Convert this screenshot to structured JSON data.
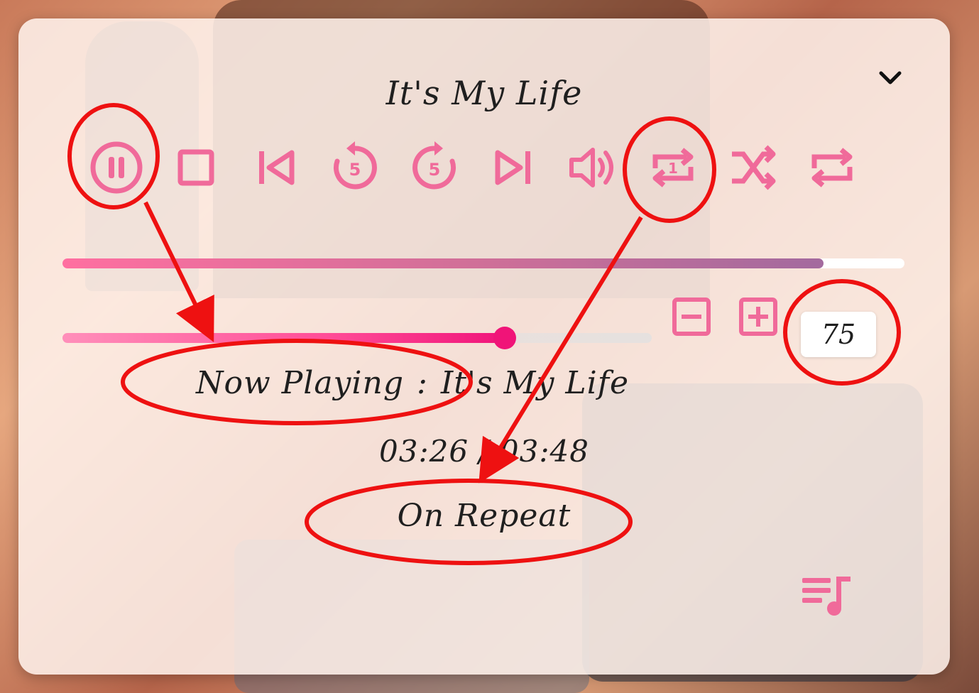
{
  "player": {
    "title": "It's My Life",
    "collapse_icon": "chevron-down-icon",
    "accent_color": "#f06a9a",
    "controls": [
      {
        "name": "pause",
        "icon": "pause-circle-icon"
      },
      {
        "name": "stop",
        "icon": "stop-icon"
      },
      {
        "name": "previous",
        "icon": "skip-previous-icon"
      },
      {
        "name": "rewind-5",
        "icon": "replay-5-icon",
        "label": "5"
      },
      {
        "name": "forward-5",
        "icon": "forward-5-icon",
        "label": "5"
      },
      {
        "name": "next",
        "icon": "skip-next-icon"
      },
      {
        "name": "volume",
        "icon": "volume-icon"
      },
      {
        "name": "repeat-one",
        "icon": "repeat-one-icon",
        "label": "1"
      },
      {
        "name": "shuffle",
        "icon": "shuffle-icon"
      },
      {
        "name": "repeat-all",
        "icon": "repeat-icon"
      }
    ],
    "progress_fraction": 0.904,
    "volume": {
      "value": "75",
      "decrease_icon": "minus-square-icon",
      "increase_icon": "plus-square-icon"
    },
    "now_playing": {
      "label": "Now Playing",
      "separator": ":",
      "track": "It's My Life"
    },
    "time": "03:26 / 03:48",
    "mode": "On Repeat",
    "playlist_icon": "playlist-music-icon"
  },
  "annotation_color": "#ee1111"
}
